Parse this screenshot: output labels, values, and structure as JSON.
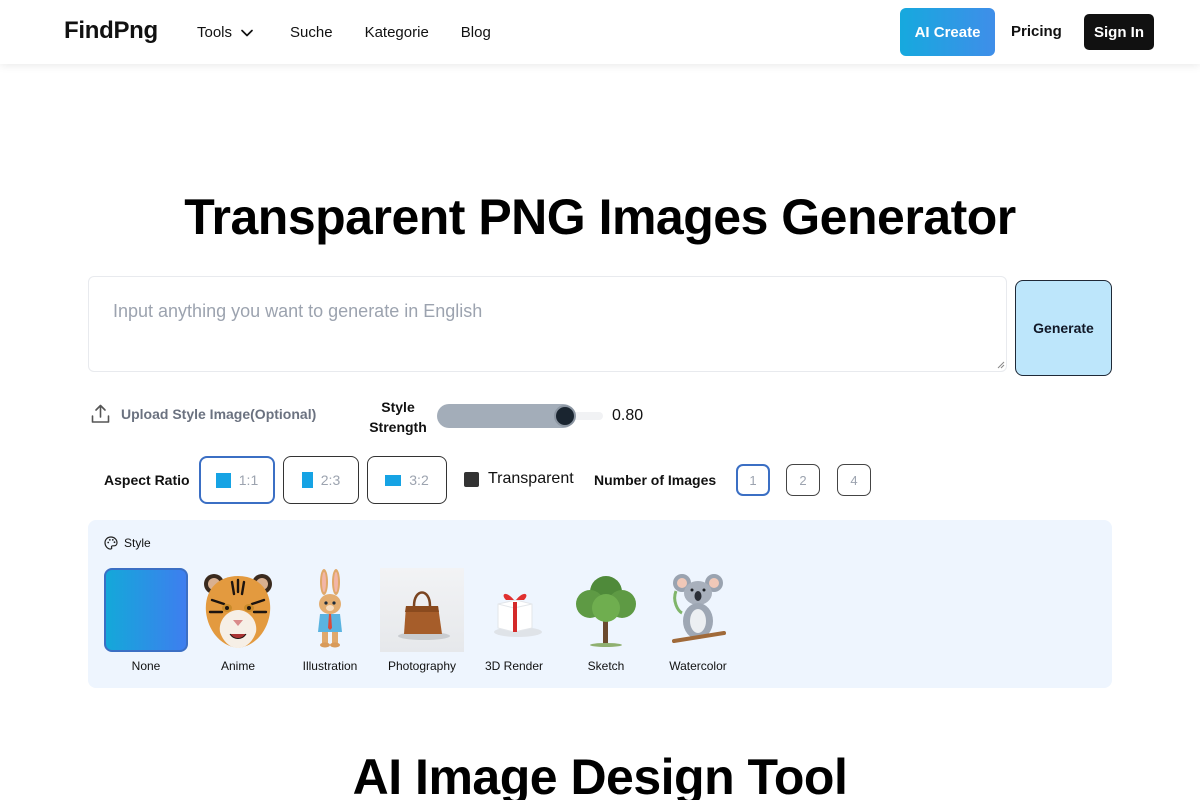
{
  "header": {
    "logo": "FindPng",
    "nav": [
      {
        "label": "Tools",
        "has_dropdown": true
      },
      {
        "label": "Suche"
      },
      {
        "label": "Kategorie"
      },
      {
        "label": "Blog"
      }
    ],
    "ai_create_label": "AI Create",
    "pricing_label": "Pricing",
    "signin_label": "Sign In"
  },
  "hero": {
    "title": "Transparent PNG Images Generator"
  },
  "prompt": {
    "placeholder": "Input anything you want to generate in English",
    "value": "",
    "generate_label": "Generate"
  },
  "controls": {
    "upload_label": "Upload Style Image(Optional)",
    "style_strength_label_line1": "Style",
    "style_strength_label_line2": "Strength",
    "style_strength_value": 0.8,
    "style_strength_display": "0.80",
    "aspect_ratio_label": "Aspect Ratio",
    "aspect_ratios": [
      {
        "label": "1:1",
        "selected": true
      },
      {
        "label": "2:3",
        "selected": false
      },
      {
        "label": "3:2",
        "selected": false
      }
    ],
    "transparent_label": "Transparent",
    "transparent_checked": true,
    "num_images_label": "Number of Images",
    "num_images": [
      {
        "label": "1",
        "selected": true
      },
      {
        "label": "2",
        "selected": false
      },
      {
        "label": "4",
        "selected": false
      }
    ]
  },
  "style_panel": {
    "heading": "Style",
    "items": [
      {
        "label": "None",
        "icon": "gradient-swatch",
        "selected": true
      },
      {
        "label": "Anime",
        "icon": "tiger-image"
      },
      {
        "label": "Illustration",
        "icon": "rabbit-image"
      },
      {
        "label": "Photography",
        "icon": "handbag-image"
      },
      {
        "label": "3D Render",
        "icon": "gift-box-image"
      },
      {
        "label": "Sketch",
        "icon": "tree-image"
      },
      {
        "label": "Watercolor",
        "icon": "koala-image"
      }
    ]
  },
  "next_section": {
    "title": "AI Image Design Tool"
  },
  "colors": {
    "accent_blue": "#16a3e4",
    "selected_border": "#3b6fc4",
    "generate_bg": "#bde6fb",
    "style_panel_bg": "#eef5fe"
  }
}
